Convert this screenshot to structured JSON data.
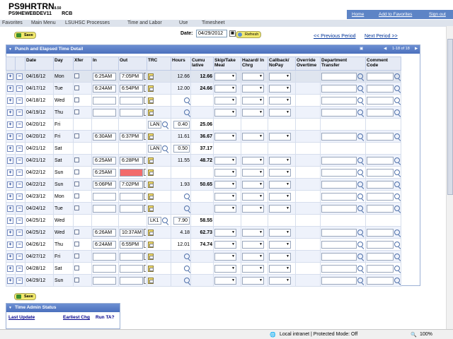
{
  "header": {
    "system": "PS9HRTRN",
    "version": "8.50",
    "database": "PS9HEWEBDEV11",
    "user": "RCB",
    "links": [
      "Home",
      "Add to Favorites",
      "Sign out"
    ]
  },
  "breadcrumb": [
    "Favorites",
    "Main Menu",
    "LSUHSC Processes",
    "Time and Labor",
    "Use",
    "Timesheet"
  ],
  "toolbar": {
    "save_label": "Save",
    "date_label": "Date:",
    "date_value": "04/29/2012",
    "refresh_label": "Refresh",
    "prev_period": "<< Previous Period",
    "next_period": "Next Period >>"
  },
  "panel": {
    "title": "Punch and Elapsed Time Detail",
    "pagination": "1-18 of 18"
  },
  "columns": [
    "",
    "",
    "Date",
    "Day",
    "Xfer",
    "In",
    "Out",
    "TRC",
    "Hours",
    "Cumu lative",
    "Skip/Take Meal",
    "Hazard/ In Chrg",
    "Callback/ NoPay",
    "Override Overtime",
    "Department Transfer",
    "Comment Code"
  ],
  "rows": [
    {
      "date": "04/16/12",
      "day": "Mon",
      "xfer": true,
      "in": "6:25AM",
      "out": "7:05PM",
      "trc": "",
      "hours": "12.66",
      "cumulative": "12.66",
      "kind": "punch",
      "out_error": false
    },
    {
      "date": "04/17/12",
      "day": "Tue",
      "xfer": true,
      "in": "6:24AM",
      "out": "6:54PM",
      "trc": "",
      "hours": "12.00",
      "cumulative": "24.66",
      "kind": "punch",
      "out_error": false
    },
    {
      "date": "04/18/12",
      "day": "Wed",
      "xfer": true,
      "in": "",
      "out": "",
      "trc": "",
      "hours": "",
      "cumulative": "",
      "kind": "punch",
      "out_error": false
    },
    {
      "date": "04/19/12",
      "day": "Thu",
      "xfer": true,
      "in": "",
      "out": "",
      "trc": "",
      "hours": "",
      "cumulative": "",
      "kind": "punch",
      "out_error": false
    },
    {
      "date": "04/20/12",
      "day": "Fri",
      "xfer": false,
      "in": "",
      "out": "",
      "trc": "LAN",
      "hours": "0.40",
      "cumulative": "25.06",
      "kind": "elapsed",
      "out_error": false
    },
    {
      "date": "04/20/12",
      "day": "Fri",
      "xfer": true,
      "in": "6:30AM",
      "out": "6:37PM",
      "trc": "",
      "hours": "11.61",
      "cumulative": "36.67",
      "kind": "punch",
      "out_error": false
    },
    {
      "date": "04/21/12",
      "day": "Sat",
      "xfer": false,
      "in": "",
      "out": "",
      "trc": "LAN",
      "hours": "0.50",
      "cumulative": "37.17",
      "kind": "elapsed",
      "out_error": false
    },
    {
      "date": "04/21/12",
      "day": "Sat",
      "xfer": true,
      "in": "6:25AM",
      "out": "6:28PM",
      "trc": "",
      "hours": "11.55",
      "cumulative": "48.72",
      "kind": "punch",
      "out_error": false
    },
    {
      "date": "04/22/12",
      "day": "Sun",
      "xfer": true,
      "in": "6:25AM",
      "out": "",
      "trc": "",
      "hours": "",
      "cumulative": "",
      "kind": "punch",
      "out_error": true
    },
    {
      "date": "04/22/12",
      "day": "Sun",
      "xfer": true,
      "in": "5:06PM",
      "out": "7:02PM",
      "trc": "",
      "hours": "1.93",
      "cumulative": "50.65",
      "kind": "punch",
      "out_error": false
    },
    {
      "date": "04/23/12",
      "day": "Mon",
      "xfer": true,
      "in": "",
      "out": "",
      "trc": "",
      "hours": "",
      "cumulative": "",
      "kind": "punch",
      "out_error": false
    },
    {
      "date": "04/24/12",
      "day": "Tue",
      "xfer": true,
      "in": "",
      "out": "",
      "trc": "",
      "hours": "",
      "cumulative": "",
      "kind": "punch",
      "out_error": false
    },
    {
      "date": "04/25/12",
      "day": "Wed",
      "xfer": false,
      "in": "",
      "out": "",
      "trc": "LK1",
      "hours": "7.90",
      "cumulative": "58.55",
      "kind": "elapsed",
      "out_error": false
    },
    {
      "date": "04/25/12",
      "day": "Wed",
      "xfer": true,
      "in": "6:26AM",
      "out": "10:37AM",
      "trc": "",
      "hours": "4.18",
      "cumulative": "62.73",
      "kind": "punch",
      "out_error": false
    },
    {
      "date": "04/26/12",
      "day": "Thu",
      "xfer": true,
      "in": "6:24AM",
      "out": "6:55PM",
      "trc": "",
      "hours": "12.01",
      "cumulative": "74.74",
      "kind": "punch",
      "out_error": false
    },
    {
      "date": "04/27/12",
      "day": "Fri",
      "xfer": true,
      "in": "",
      "out": "",
      "trc": "",
      "hours": "",
      "cumulative": "",
      "kind": "punch",
      "out_error": false
    },
    {
      "date": "04/28/12",
      "day": "Sat",
      "xfer": true,
      "in": "",
      "out": "",
      "trc": "",
      "hours": "",
      "cumulative": "",
      "kind": "punch",
      "out_error": false
    },
    {
      "date": "04/29/12",
      "day": "Sun",
      "xfer": true,
      "in": "",
      "out": "",
      "trc": "",
      "hours": "",
      "cumulative": "",
      "kind": "punch",
      "out_error": false
    }
  ],
  "admin": {
    "title": "Time Admin Status",
    "headers": [
      "Last Update",
      "Earliest Chg",
      "Run TA?"
    ]
  },
  "status_bar": {
    "zone": "Local intranet | Protected Mode: Off",
    "zoom": "100%"
  }
}
